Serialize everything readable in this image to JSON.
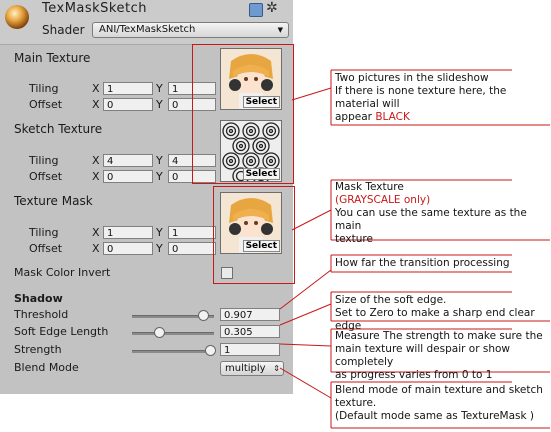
{
  "header": {
    "title": "TexMaskSketch",
    "shader_label": "Shader",
    "shader_value": "ANI/TexMaskSketch"
  },
  "main_texture": {
    "label": "Main Texture",
    "tiling_label": "Tiling",
    "offset_label": "Offset",
    "tiling_x": "1",
    "tiling_y": "1",
    "offset_x": "0",
    "offset_y": "0",
    "select_label": "Select"
  },
  "sketch_texture": {
    "label": "Sketch Texture",
    "tiling_label": "Tiling",
    "offset_label": "Offset",
    "tiling_x": "4",
    "tiling_y": "4",
    "offset_x": "0",
    "offset_y": "0",
    "select_label": "Select"
  },
  "texture_mask": {
    "label": "Texture Mask",
    "tiling_label": "Tiling",
    "offset_label": "Offset",
    "tiling_x": "1",
    "tiling_y": "1",
    "offset_x": "0",
    "offset_y": "0",
    "select_label": "Select"
  },
  "axes": {
    "x": "X",
    "y": "Y"
  },
  "mask_color_invert": {
    "label": "Mask Color Invert",
    "checked": false
  },
  "shadow": {
    "heading": "Shadow",
    "threshold": {
      "label": "Threshold",
      "value": "0.907",
      "level": 0.907
    },
    "soft_edge_length": {
      "label": "Soft Edge Length",
      "value": "0.305",
      "level": 0.305
    },
    "strength": {
      "label": "Strength",
      "value": "1",
      "level": 1.0
    }
  },
  "blend_mode": {
    "label": "Blend Mode",
    "value": "multiply"
  },
  "annotations": {
    "main_texture_note": {
      "line1": "Two pictures in the slideshow",
      "line2": "If there is none texture here, the material will",
      "line3_prefix": "appear ",
      "line3_red": "BLACK"
    },
    "mask_note": {
      "line1": "Mask Texture",
      "line2_red": "(GRAYSCALE only)",
      "line3": "You can use the same texture as the main",
      "line4": "texture"
    },
    "transition_note": "How far the transition processing",
    "soft_edge_note": {
      "line1": "Size of the soft edge.",
      "line2": "Set to Zero to make a sharp end clear edge"
    },
    "strength_note": {
      "line1": "Measure The strength to make sure the",
      "line2": "main texture will despair or show completely",
      "line3": "as progress varies from 0 to 1"
    },
    "blend_note": {
      "line1": "Blend mode of main texture and sketch",
      "line2": "texture.",
      "line3": "(Default mode same as TextureMask )"
    }
  },
  "colors": {
    "annotation_red": "#c81919",
    "panel_bg": "#c2c2c2"
  }
}
